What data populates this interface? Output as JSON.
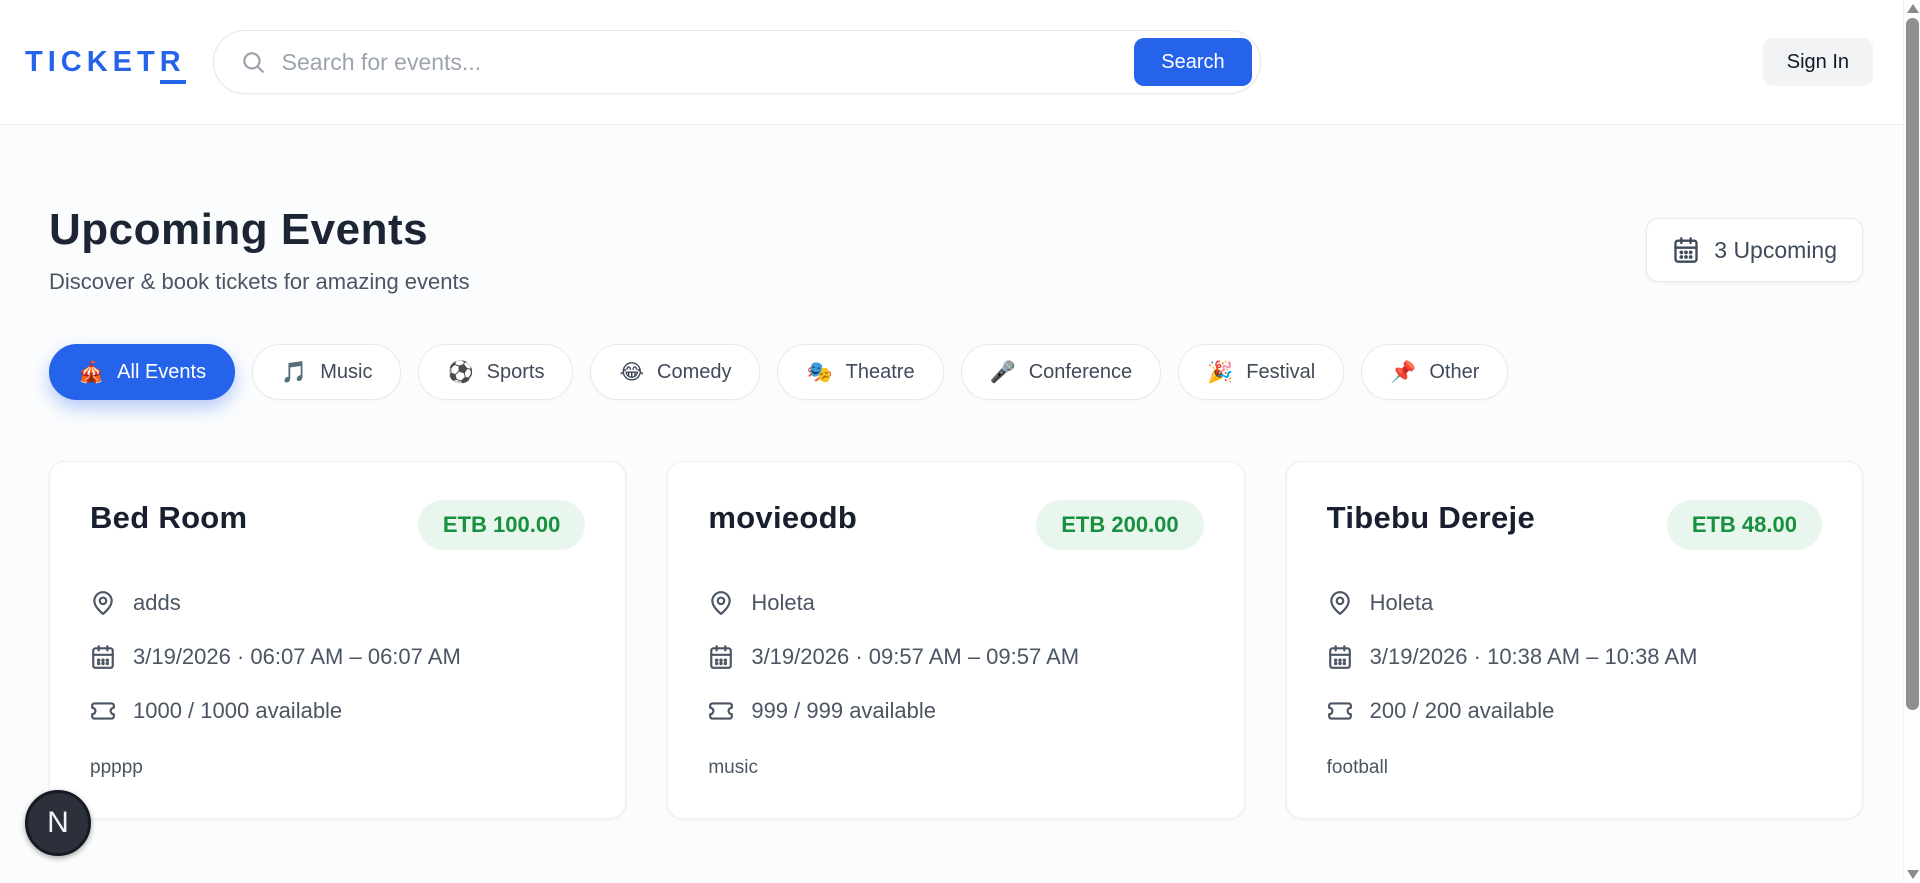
{
  "brand": {
    "logo_prefix": "TICKET",
    "logo_suffix": "R"
  },
  "header": {
    "search_placeholder": "Search for events...",
    "search_button": "Search",
    "sign_in": "Sign In"
  },
  "page": {
    "title": "Upcoming Events",
    "subtitle": "Discover & book tickets for amazing events",
    "upcoming_badge": "3 Upcoming"
  },
  "filters": [
    {
      "emoji": "🎪",
      "label": "All Events",
      "active": true
    },
    {
      "emoji": "🎵",
      "label": "Music",
      "active": false
    },
    {
      "emoji": "⚽",
      "label": "Sports",
      "active": false
    },
    {
      "emoji": "😂",
      "label": "Comedy",
      "active": false
    },
    {
      "emoji": "🎭",
      "label": "Theatre",
      "active": false
    },
    {
      "emoji": "🎤",
      "label": "Conference",
      "active": false
    },
    {
      "emoji": "🎉",
      "label": "Festival",
      "active": false
    },
    {
      "emoji": "📌",
      "label": "Other",
      "active": false
    }
  ],
  "events": [
    {
      "title": "Bed Room",
      "price": "ETB 100.00",
      "location": "adds",
      "datetime": "3/19/2026 · 06:07 AM – 06:07 AM",
      "availability": "1000 / 1000 available",
      "tag": "ppppp"
    },
    {
      "title": "movieodb",
      "price": "ETB 200.00",
      "location": "Holeta",
      "datetime": "3/19/2026 · 09:57 AM – 09:57 AM",
      "availability": "999 / 999 available",
      "tag": "music"
    },
    {
      "title": "Tibebu Dereje",
      "price": "ETB 48.00",
      "location": "Holeta",
      "datetime": "3/19/2026 · 10:38 AM – 10:38 AM",
      "availability": "200 / 200 available",
      "tag": "football"
    }
  ],
  "dev_button": "N",
  "colors": {
    "accent_blue": "#2563eb",
    "price_green": "#17903f",
    "price_bg": "#e9f6ee",
    "title_dark": "#1c2534",
    "body_gray": "#4b5563"
  }
}
